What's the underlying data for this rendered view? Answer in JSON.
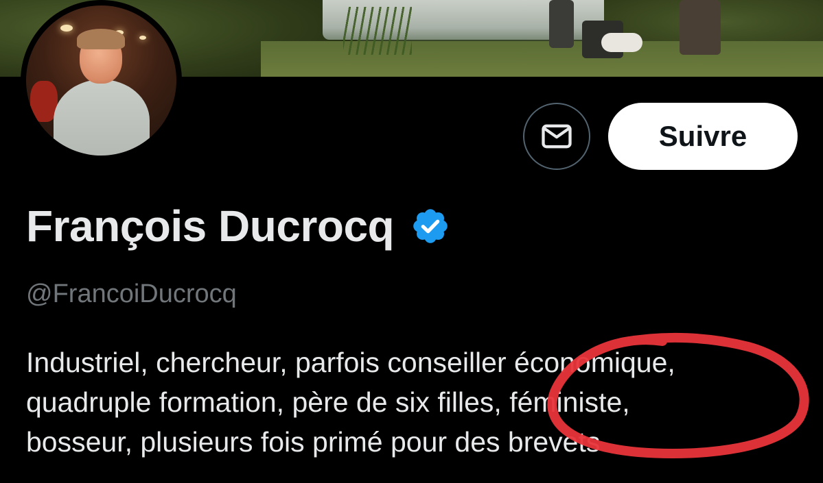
{
  "profile": {
    "display_name": "François Ducrocq",
    "verified": true,
    "handle": "@FrancoiDucrocq",
    "bio_lines": [
      "Industriel, chercheur, parfois conseiller économique,",
      "quadruple formation, père de six filles, féministe,",
      "bosseur, plusieurs fois primé pour des brevets"
    ]
  },
  "actions": {
    "message_icon": "envelope-icon",
    "follow_label": "Suivre"
  },
  "colors": {
    "background": "#000000",
    "verified_blue": "#1d9bf0",
    "annotation_red": "#e8353a",
    "handle_gray": "#71767b",
    "text": "#e7e9ea"
  }
}
